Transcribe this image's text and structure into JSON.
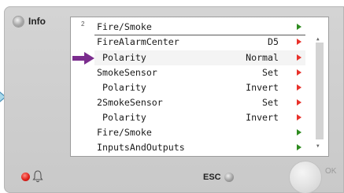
{
  "panel": {
    "info_label": "Info",
    "page_number": "2",
    "esc_label": "ESC",
    "ok_label": "OK"
  },
  "menu": {
    "title": {
      "label": "Fire/Smoke",
      "arrow": "green"
    },
    "rows": [
      {
        "label": "FireAlarmCenter",
        "value": "D5",
        "arrow": "red"
      },
      {
        "label": " Polarity",
        "value": "Normal",
        "arrow": "red"
      },
      {
        "label": "SmokeSensor",
        "value": "Set",
        "arrow": "red"
      },
      {
        "label": " Polarity",
        "value": "Invert",
        "arrow": "red"
      },
      {
        "label": "2SmokeSensor",
        "value": "Set",
        "arrow": "red"
      },
      {
        "label": " Polarity",
        "value": "Invert",
        "arrow": "red"
      },
      {
        "label": "Fire/Smoke",
        "value": "",
        "arrow": "green"
      },
      {
        "label": "InputsAndOutputs",
        "value": "",
        "arrow": "green"
      }
    ]
  },
  "colors": {
    "arrow_green": "#2e8b1f",
    "arrow_red": "#e8312a",
    "pointer": "#7b2d8e",
    "alarm_led": "#e0201a"
  }
}
